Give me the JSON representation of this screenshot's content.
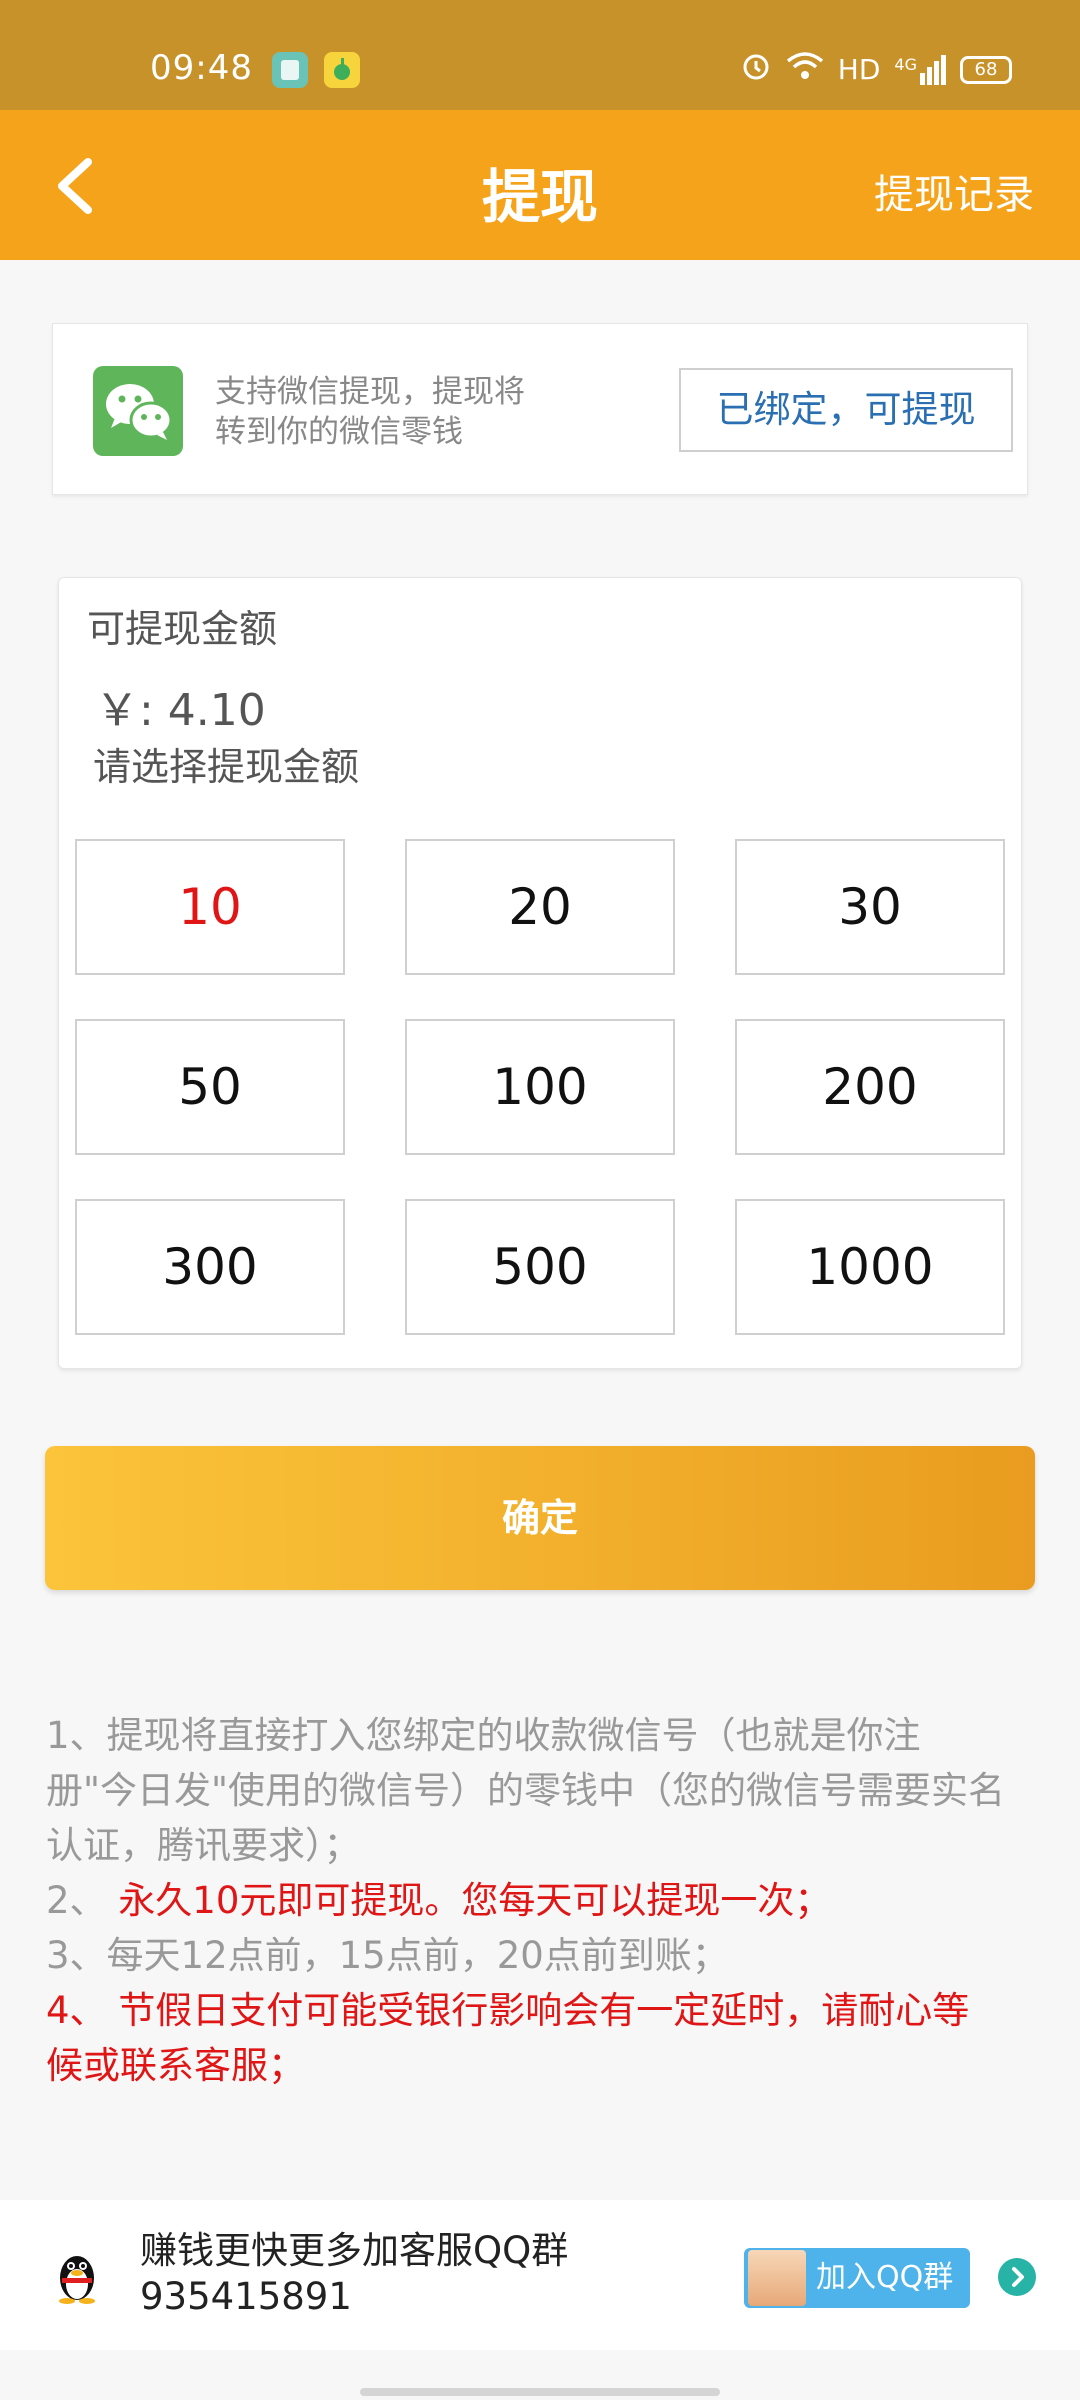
{
  "status_bar": {
    "time": "09:48",
    "network": "HD",
    "signal": "4G",
    "battery": "68",
    "icons": [
      "clipboard-app-icon",
      "qq-music-app-icon",
      "alarm-icon",
      "wifi-icon",
      "signal-icon",
      "battery-icon"
    ]
  },
  "header": {
    "back_icon": "back-arrow-icon",
    "title": "提现",
    "action": "提现记录"
  },
  "wechat": {
    "icon": "wechat-icon",
    "line1": "支持微信提现，提现将",
    "line2": "转到你的微信零钱",
    "bind_label": "已绑定，可提现"
  },
  "amount": {
    "label": "可提现金额",
    "balance": "￥: 4.10",
    "prompt": "请选择提现金额",
    "selected": "10",
    "options": [
      "10",
      "20",
      "30",
      "50",
      "100",
      "200",
      "300",
      "500",
      "1000"
    ]
  },
  "confirm": {
    "label": "确定"
  },
  "notes": {
    "n1": "1、提现将直接打入您绑定的收款微信号（也就是你注册\"今日发\"使用的微信号）的零钱中（您的微信号需要实名认证，腾讯要求）；",
    "n2_prefix": "2、",
    "n2": "永久10元即可提现。您每天可以提现一次；",
    "n3": "3、每天12点前，15点前，20点前到账；",
    "n4_prefix": "4、",
    "n4": "节假日支付可能受银行影响会有一定延时，请耐心等候或联系客服；"
  },
  "footer": {
    "icon": "qq-penguin-icon",
    "line1": "赚钱更快更多加客服QQ群",
    "line2": "935415891",
    "join_label": "加入QQ群",
    "arrow_icon": "chevron-right-circle-icon"
  },
  "colors": {
    "status_bar": "#c8922b",
    "header": "#f5a31a",
    "selected_text": "#e01515",
    "link_blue": "#2a6fb1",
    "wechat_green": "#5fb55a"
  }
}
